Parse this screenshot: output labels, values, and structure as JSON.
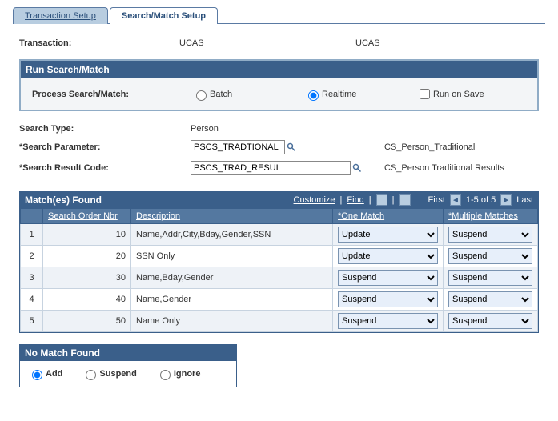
{
  "tabs": {
    "inactive": "Transaction Setup",
    "active": "Search/Match Setup"
  },
  "transaction_label": "Transaction:",
  "transaction_code": "UCAS",
  "transaction_name": "UCAS",
  "run_section": {
    "title": "Run Search/Match",
    "process_label": "Process Search/Match:",
    "batch": "Batch",
    "realtime": "Realtime",
    "run_on_save": "Run on Save"
  },
  "search_type_label": "Search Type:",
  "search_type_value": "Person",
  "search_param_label": "*Search Parameter:",
  "search_param_value": "PSCS_TRADTIONAL",
  "search_param_desc": "CS_Person_Traditional",
  "search_result_label": "*Search Result Code:",
  "search_result_value": "PSCS_TRAD_RESUL",
  "search_result_desc": "CS_Person Traditional Results",
  "grid": {
    "title": "Match(es) Found",
    "customize": "Customize",
    "find": "Find",
    "first": "First",
    "range": "1-5 of 5",
    "last": "Last",
    "cols": {
      "blank": "",
      "order": "Search Order Nbr",
      "desc": "Description",
      "one": "*One Match",
      "multi": "*Multiple Matches"
    },
    "rows": [
      {
        "n": "1",
        "order": "10",
        "desc": "Name,Addr,City,Bday,Gender,SSN",
        "one": "Update",
        "multi": "Suspend"
      },
      {
        "n": "2",
        "order": "20",
        "desc": "SSN Only",
        "one": "Update",
        "multi": "Suspend"
      },
      {
        "n": "3",
        "order": "30",
        "desc": "Name,Bday,Gender",
        "one": "Suspend",
        "multi": "Suspend"
      },
      {
        "n": "4",
        "order": "40",
        "desc": "Name,Gender",
        "one": "Suspend",
        "multi": "Suspend"
      },
      {
        "n": "5",
        "order": "50",
        "desc": "Name Only",
        "one": "Suspend",
        "multi": "Suspend"
      }
    ]
  },
  "nomatch": {
    "title": "No Match Found",
    "add": "Add",
    "suspend": "Suspend",
    "ignore": "Ignore"
  }
}
